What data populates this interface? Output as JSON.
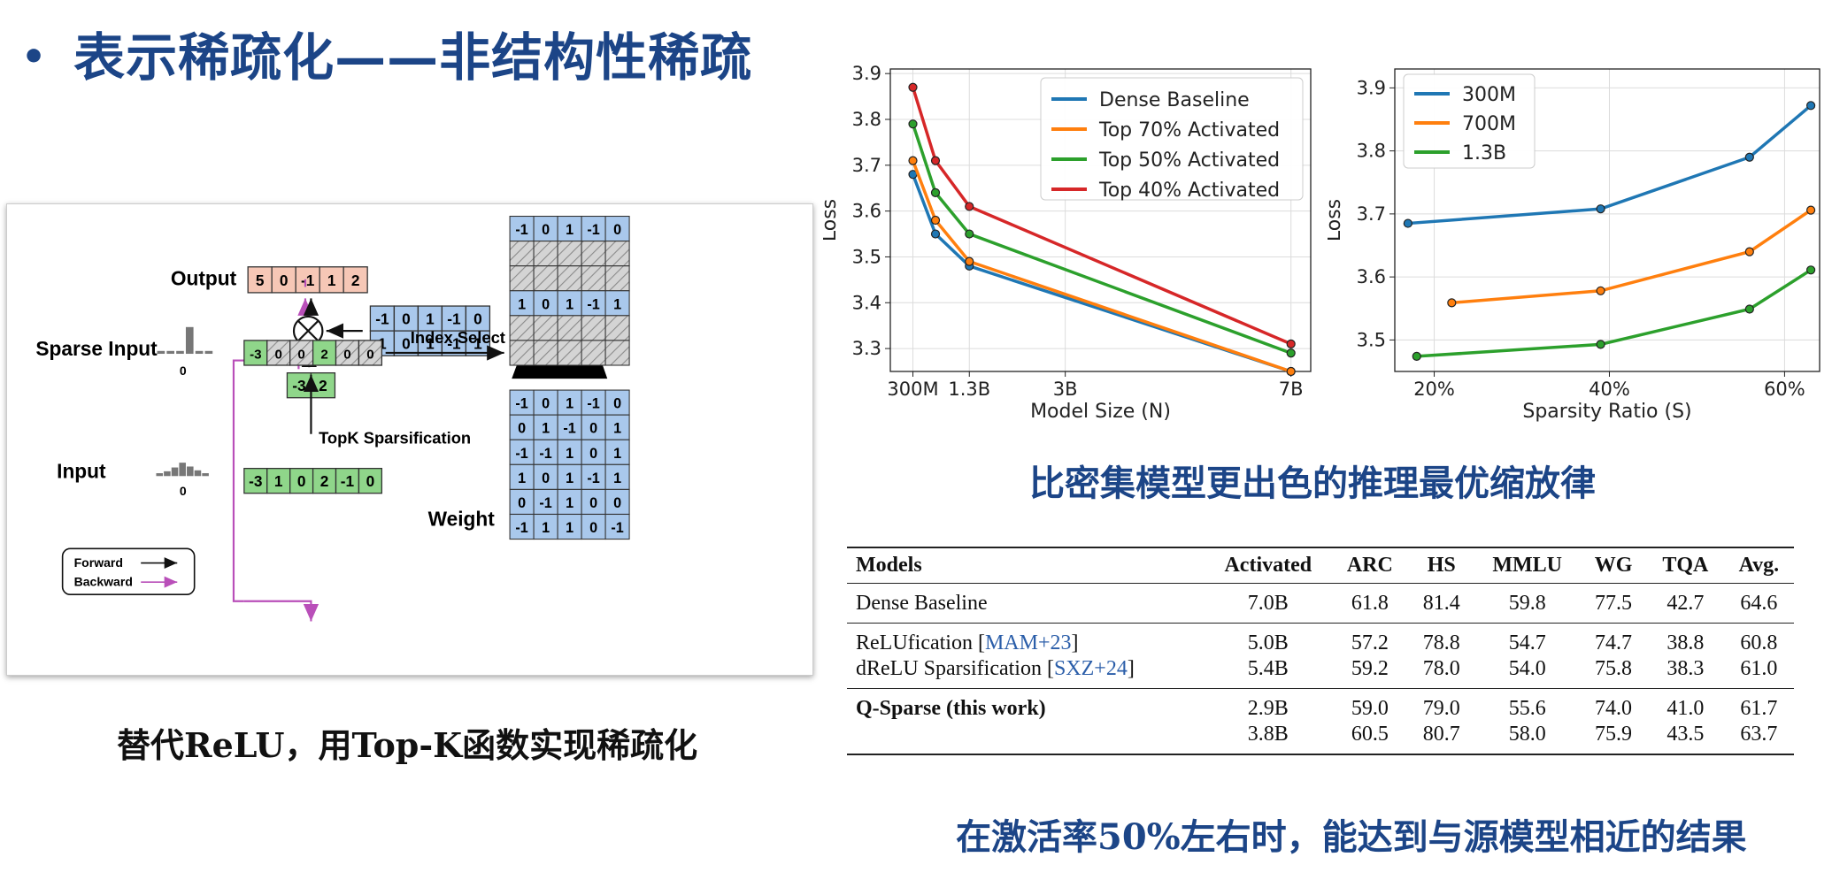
{
  "title": "表示稀疏化——非结构性稀疏",
  "caption_left": "替代ReLU，用Top-K函数实现稀疏化",
  "caption_charts": "比密集模型更出色的推理最优缩放律",
  "caption_table": "在激活率50%左右时，能达到与源模型相近的结果",
  "diagram": {
    "output_label": "Output",
    "output_values": [
      "5",
      "0",
      "-1",
      "1",
      "2"
    ],
    "sparse_input_label": "Sparse Input",
    "input_label": "Input",
    "weight_label": "Weight",
    "index_select_label": "Index Select",
    "topk_label": "TopK Sparsification",
    "zero_tick": "0",
    "selected_rows": [
      [
        "-1",
        "0",
        "1",
        "-1",
        "0"
      ],
      [
        "1",
        "0",
        "1",
        "-1",
        "1"
      ]
    ],
    "selected_values": [
      "-3",
      "2"
    ],
    "sparse_values": [
      "-3",
      "0",
      "0",
      "2",
      "0",
      "0"
    ],
    "input_values": [
      "-3",
      "1",
      "0",
      "2",
      "-1",
      "0"
    ],
    "top_matrix_rows": [
      [
        "-1",
        "0",
        "1",
        "-1",
        "0"
      ],
      null,
      null,
      [
        "1",
        "0",
        "1",
        "-1",
        "1"
      ],
      null,
      null
    ],
    "weight_rows": [
      [
        "-1",
        "0",
        "1",
        "-1",
        "0"
      ],
      [
        "0",
        "1",
        "-1",
        "0",
        "1"
      ],
      [
        "-1",
        "-1",
        "1",
        "0",
        "1"
      ],
      [
        "1",
        "0",
        "1",
        "-1",
        "1"
      ],
      [
        "0",
        "-1",
        "1",
        "0",
        "0"
      ],
      [
        "-1",
        "1",
        "1",
        "0",
        "-1"
      ]
    ],
    "legend_forward": "Forward",
    "legend_backward": "Backward",
    "colors": {
      "output": "#f6c7b6",
      "blue": "#a9c8ec",
      "green": "#8fd68a",
      "purple": "#b94fb9",
      "hatch": "#cfcfcf"
    }
  },
  "chart_data": [
    {
      "type": "line",
      "xlabel": "Model Size (N)",
      "ylabel": "Loss",
      "x_tick_labels": [
        "300M",
        "1.3B",
        "3B",
        "7B"
      ],
      "x_ticks": [
        0.3,
        1.3,
        3,
        7
      ],
      "y_ticks": [
        3.3,
        3.4,
        3.5,
        3.6,
        3.7,
        3.8,
        3.9
      ],
      "xlim": [
        -0.1,
        7.35
      ],
      "ylim": [
        3.25,
        3.91
      ],
      "legend_position": "top-right",
      "grid": true,
      "series": [
        {
          "name": "Dense Baseline",
          "color": "#1f77b4",
          "x": [
            0.3,
            0.7,
            1.3,
            7
          ],
          "y": [
            3.68,
            3.55,
            3.48,
            3.25
          ]
        },
        {
          "name": "Top 70% Activated",
          "color": "#ff7f0e",
          "x": [
            0.3,
            0.7,
            1.3,
            7
          ],
          "y": [
            3.71,
            3.58,
            3.49,
            3.25
          ]
        },
        {
          "name": "Top 50% Activated",
          "color": "#2ca02c",
          "x": [
            0.3,
            0.7,
            1.3,
            7
          ],
          "y": [
            3.79,
            3.64,
            3.55,
            3.29
          ]
        },
        {
          "name": "Top 40% Activated",
          "color": "#d62728",
          "x": [
            0.3,
            0.7,
            1.3,
            7
          ],
          "y": [
            3.87,
            3.71,
            3.61,
            3.31
          ]
        }
      ]
    },
    {
      "type": "line",
      "xlabel": "Sparsity Ratio (S)",
      "ylabel": "Loss",
      "x_tick_labels": [
        "20%",
        "40%",
        "60%"
      ],
      "x_ticks": [
        20,
        40,
        60
      ],
      "y_ticks": [
        3.5,
        3.6,
        3.7,
        3.8,
        3.9
      ],
      "xlim": [
        15.5,
        64
      ],
      "ylim": [
        3.45,
        3.93
      ],
      "legend_position": "top-left",
      "grid": true,
      "series": [
        {
          "name": "300M",
          "color": "#1f77b4",
          "x": [
            17,
            39,
            56,
            63
          ],
          "y": [
            3.685,
            3.708,
            3.79,
            3.872
          ]
        },
        {
          "name": "700M",
          "color": "#ff7f0e",
          "x": [
            22,
            39,
            56,
            63
          ],
          "y": [
            3.559,
            3.578,
            3.64,
            3.706
          ]
        },
        {
          "name": "1.3B",
          "color": "#2ca02c",
          "x": [
            18,
            39,
            56,
            63
          ],
          "y": [
            3.474,
            3.493,
            3.549,
            3.611
          ]
        }
      ]
    }
  ],
  "table": {
    "headers": [
      "Models",
      "Activated",
      "ARC",
      "HS",
      "MMLU",
      "WG",
      "TQA",
      "Avg."
    ],
    "groups": [
      [
        {
          "model": "Dense Baseline",
          "cite": "",
          "values": [
            "7.0B",
            "61.8",
            "81.4",
            "59.8",
            "77.5",
            "42.7",
            "64.6"
          ]
        }
      ],
      [
        {
          "model": "ReLUfication [",
          "cite": "MAM+23",
          "suffix": "]",
          "values": [
            "5.0B",
            "57.2",
            "78.8",
            "54.7",
            "74.7",
            "38.8",
            "60.8"
          ]
        },
        {
          "model": "dReLU Sparsification [",
          "cite": "SXZ+24",
          "suffix": "]",
          "values": [
            "5.4B",
            "59.2",
            "78.0",
            "54.0",
            "75.8",
            "38.3",
            "61.0"
          ]
        }
      ],
      [
        {
          "model": "Q-Sparse (this work)",
          "bold": true,
          "values": [
            "2.9B",
            "59.0",
            "79.0",
            "55.6",
            "74.0",
            "41.0",
            "61.7"
          ]
        },
        {
          "model": "",
          "values": [
            "3.8B",
            "60.5",
            "80.7",
            "58.0",
            "75.9",
            "43.5",
            "63.7"
          ]
        }
      ]
    ]
  }
}
